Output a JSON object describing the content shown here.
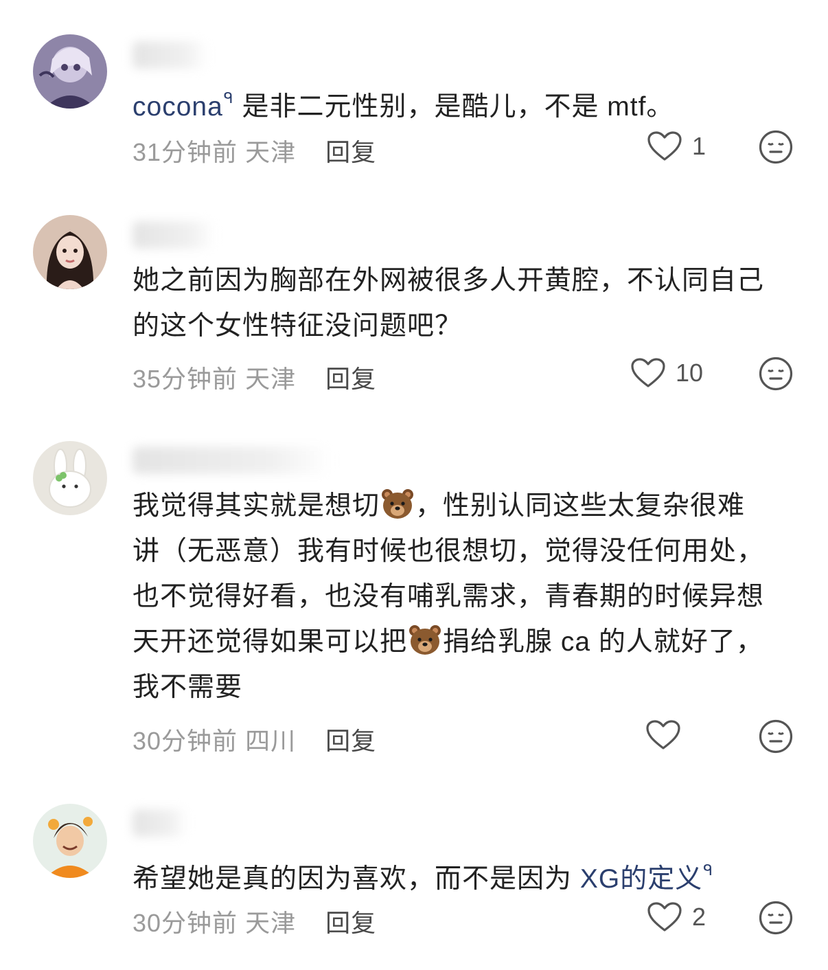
{
  "comments": [
    {
      "id": 1,
      "mention": "cocona",
      "text": "是非二元性别，是酷儿，不是 mtf。",
      "time": "31分钟前",
      "location": "天津",
      "reply_label": "回复",
      "likes": "1"
    },
    {
      "id": 2,
      "lines": [
        "她之前因为胸部在外网被很多人开黄腔，不认同自己",
        "的这个女性特征没问题吧？"
      ],
      "time": "35分钟前",
      "location": "天津",
      "reply_label": "回复",
      "likes": "10"
    },
    {
      "id": 3,
      "line1_a": "我觉得其实就是想切",
      "line1_b": "，性别认同这些太复杂很难",
      "line2": "讲（无恶意）我有时候也很想切，觉得没任何用处，",
      "line3": "也不觉得好看，也没有哺乳需求，青春期的时候异想",
      "line4_a": "天开还觉得如果可以把",
      "line4_b": "捐给乳腺 ca 的人就好了，",
      "line5": "我不需要",
      "time": "30分钟前",
      "location": "四川",
      "reply_label": "回复",
      "likes": ""
    },
    {
      "id": 4,
      "text": "希望她是真的因为喜欢，而不是因为",
      "tag": "XG的定义",
      "time": "30分钟前",
      "location": "天津",
      "reply_label": "回复",
      "likes": "2"
    }
  ],
  "icons": {
    "like": "heart-outline-icon",
    "dislike": "meh-face-icon",
    "search_mark": "search-icon",
    "emoji": "bear-emoji"
  },
  "colors": {
    "link": "#2b3f6e",
    "meta": "#9a9a9a",
    "body": "#222222"
  }
}
